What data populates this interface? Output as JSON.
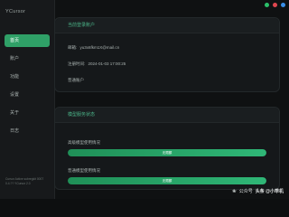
{
  "app": {
    "title": "YCursor"
  },
  "window": {
    "controls": [
      "minimize",
      "close",
      "maximize"
    ]
  },
  "sidebar": {
    "items": [
      {
        "label": "首页",
        "active": true
      },
      {
        "label": "账户",
        "active": false
      },
      {
        "label": "功能",
        "active": false
      },
      {
        "label": "设置",
        "active": false
      },
      {
        "label": "关于",
        "active": false
      },
      {
        "label": "日志",
        "active": false
      }
    ],
    "footer_line1": "Cursor Active subregkit 0007",
    "footer_line2": "0.4.??  YCursor 2.0"
  },
  "account_card": {
    "title": "当前登录账户",
    "email_label": "邮箱:",
    "email_value": "yu3x6fkm1X@mail.cn",
    "time_label": "注册时间:",
    "time_value": "2024-01-03 17:00:25",
    "status_label": "普通账户"
  },
  "switch_card": {
    "title": "模型服务状态",
    "service1_label": "高级模型使用情况",
    "service1_bar_text": "无限额",
    "service1_progress": 1.0,
    "service2_label": "普通模型使用情况",
    "service2_bar_text": "无限额",
    "service2_progress": 1.0
  },
  "watermark": {
    "source": "公众号",
    "author": "头条 @小乖机"
  },
  "colors": {
    "accent": "#2fa067",
    "background": "#0f1112",
    "card": "#15181a"
  }
}
